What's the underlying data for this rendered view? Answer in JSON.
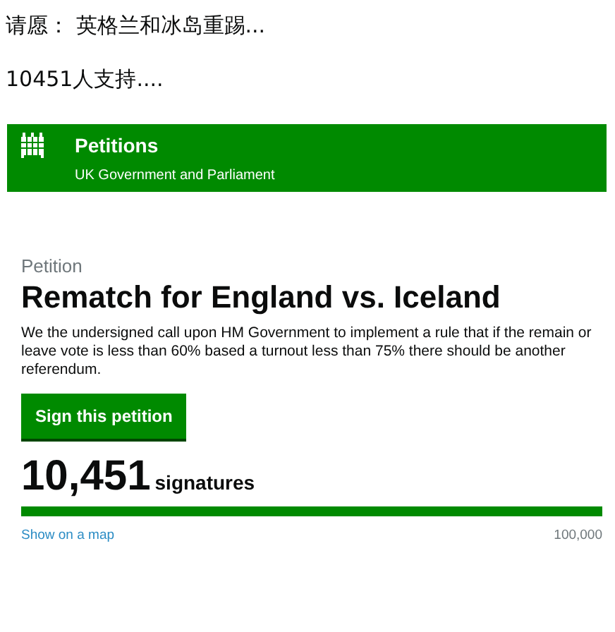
{
  "caption": {
    "title": "请愿： 英格兰和冰岛重踢...",
    "supporters": "10451人支持...."
  },
  "header": {
    "title": "Petitions",
    "subtitle": "UK Government and Parliament"
  },
  "petition": {
    "label": "Petition",
    "title": "Rematch for England vs. Iceland",
    "body": "We the undersigned call upon HM Government to implement a rule that if the remain or leave vote is less than 60% based a turnout less than 75% there should be another referendum.",
    "button": "Sign this petition",
    "count": "10,451",
    "count_label": "signatures",
    "progress": {
      "level": 1
    },
    "map_link": "Show on a map",
    "target": "100,000"
  }
}
